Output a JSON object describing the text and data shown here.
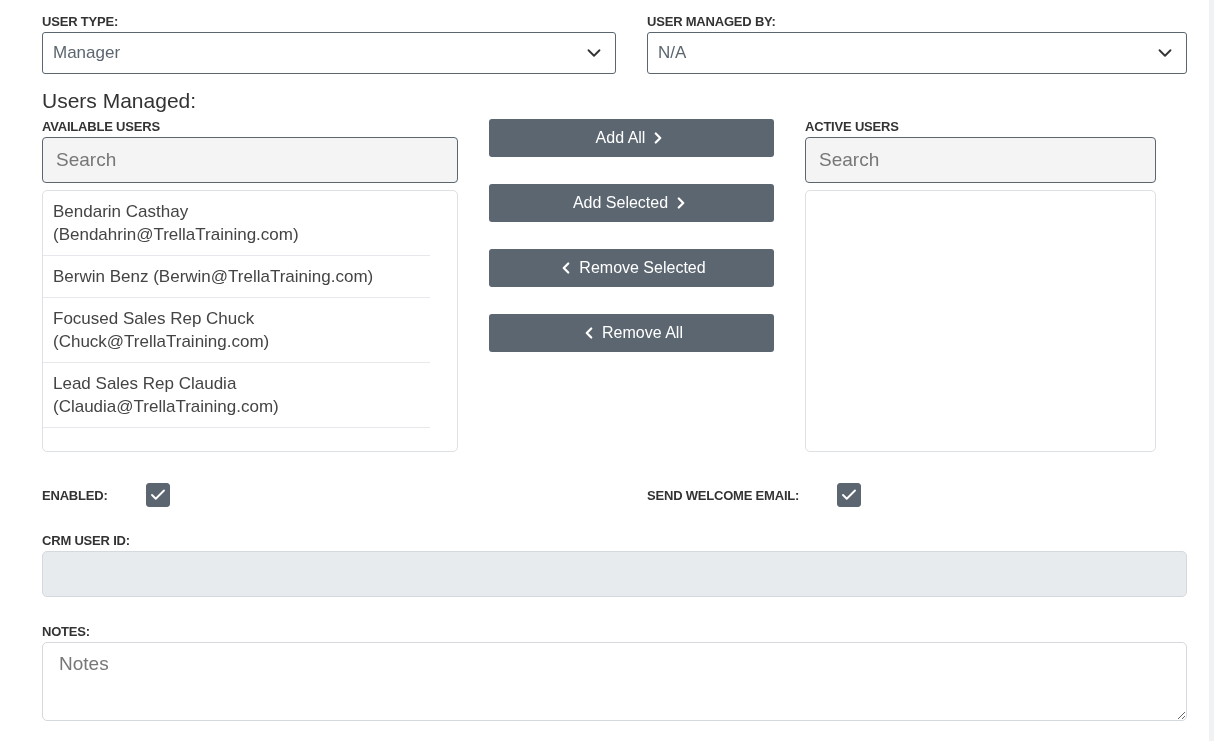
{
  "user_type": {
    "label": "USER TYPE:",
    "value": "Manager"
  },
  "user_managed_by": {
    "label": "USER MANAGED BY:",
    "value": "N/A"
  },
  "users_managed": {
    "heading": "Users Managed:",
    "available": {
      "label": "AVAILABLE USERS",
      "search_placeholder": "Search",
      "items": [
        {
          "name": "Bendarin Casthay",
          "email": "(Bendahrin@TrellaTraining.com)",
          "selected": false
        },
        {
          "name": "Berwin Benz",
          "email": "(Berwin@TrellaTraining.com)",
          "selected": false
        },
        {
          "name": "Focused Sales Rep Chuck",
          "email": "(Chuck@TrellaTraining.com)",
          "selected": false
        },
        {
          "name": "Lead Sales Rep Claudia",
          "email": "(Claudia@TrellaTraining.com)",
          "selected": false
        }
      ]
    },
    "buttons": [
      {
        "label": "Add All",
        "kind": "forward"
      },
      {
        "label": "Add Selected",
        "kind": "forward"
      },
      {
        "label": "Remove Selected",
        "kind": "back"
      },
      {
        "label": "Remove All",
        "kind": "back"
      }
    ],
    "active": {
      "label": "ACTIVE USERS",
      "search_placeholder": "Search"
    }
  },
  "enabled": {
    "label": "ENABLED:",
    "checked": true
  },
  "send_welcome_email": {
    "label": "SEND WELCOME EMAIL:",
    "checked": true
  },
  "crm_user_id": {
    "label": "CRM USER ID:",
    "disabled": true
  },
  "notes": {
    "label": "NOTES:",
    "placeholder": "Notes"
  }
}
